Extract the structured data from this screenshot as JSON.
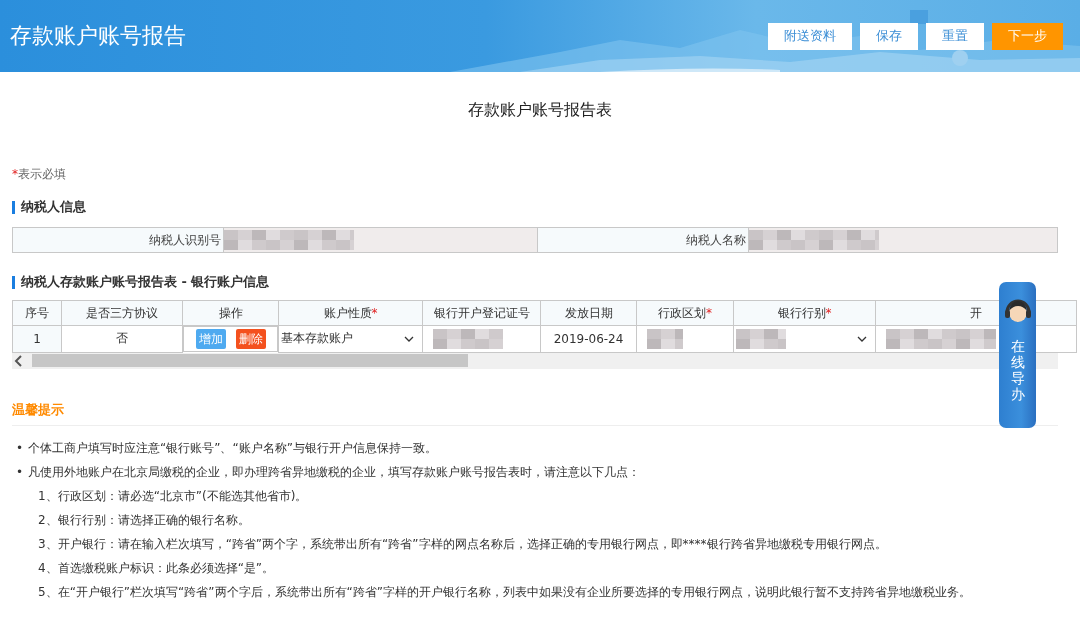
{
  "header": {
    "title": "存款账户账号报告",
    "buttons": [
      {
        "label": "附送资料",
        "kind": "plain"
      },
      {
        "label": "保存",
        "kind": "plain"
      },
      {
        "label": "重置",
        "kind": "plain"
      },
      {
        "label": "下一步",
        "kind": "primary"
      }
    ]
  },
  "form_title": "存款账户账号报告表",
  "required_note": {
    "mark": "*",
    "text": "表示必填"
  },
  "taxpayer_section": {
    "title": "纳税人信息",
    "fields": [
      {
        "label": "纳税人识别号"
      },
      {
        "label": "纳税人名称"
      }
    ]
  },
  "bank_section": {
    "title": "纳税人存款账户账号报告表 - 银行账户信息",
    "columns": [
      {
        "label": "序号",
        "required": false
      },
      {
        "label": "是否三方协议",
        "required": false
      },
      {
        "label": "操作",
        "required": false
      },
      {
        "label": "账户性质",
        "required": true
      },
      {
        "label": "银行开户登记证号",
        "required": false
      },
      {
        "label": "发放日期",
        "required": false
      },
      {
        "label": "行政区划",
        "required": true
      },
      {
        "label": "银行行别",
        "required": true
      },
      {
        "label": "开",
        "required": false
      }
    ],
    "rows": [
      {
        "index": "1",
        "tripartite": "否",
        "actions": [
          {
            "label": "增加",
            "kind": "add"
          },
          {
            "label": "删除",
            "kind": "delete"
          }
        ],
        "account_type": "基本存款账户",
        "issue_date": "2019-06-24"
      }
    ]
  },
  "online_guide": {
    "label": "在线导办"
  },
  "tips": {
    "title": "温馨提示",
    "items": [
      {
        "bullet": "•",
        "text": "个体工商户填写时应注意“银行账号”、“账户名称”与银行开户信息保持一致。"
      },
      {
        "bullet": "•",
        "text": "凡使用外地账户在北京局缴税的企业，即办理跨省异地缴税的企业，填写存款账户账号报告表时，请注意以下几点：",
        "children": [
          {
            "text": "1、行政区划：请必选“北京市”(不能选其他省市)。"
          },
          {
            "text": "2、银行行别：请选择正确的银行名称。"
          },
          {
            "text": "3、开户银行：请在输入栏次填写，“跨省”两个字，系统带出所有“跨省”字样的网点名称后，选择正确的专用银行网点，即****银行跨省异地缴税专用银行网点。"
          },
          {
            "text": "4、首选缴税账户标识：此条必须选择“是”。"
          },
          {
            "text": "5、在“开户银行”栏次填写“跨省”两个字后，系统带出所有“跨省”字样的开户银行名称，列表中如果没有企业所要选择的专用银行网点，说明此银行暂不支持跨省异地缴税业务。"
          }
        ]
      }
    ]
  }
}
